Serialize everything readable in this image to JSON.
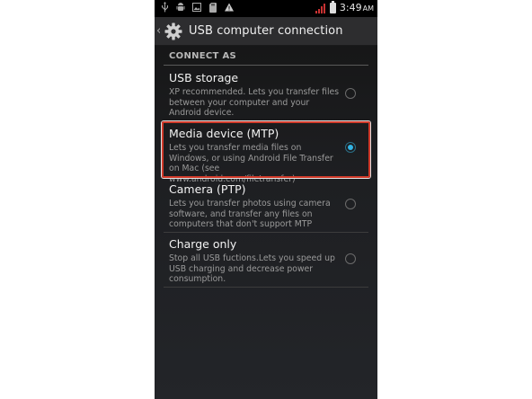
{
  "status_bar": {
    "icons": [
      "usb-icon",
      "android-debug-icon",
      "image-icon",
      "sd-card-icon",
      "warning-icon"
    ],
    "time": "3:49",
    "ampm": "AM"
  },
  "action_bar": {
    "title": "USB computer connection"
  },
  "section": {
    "header": "CONNECT AS"
  },
  "options": [
    {
      "title": "USB storage",
      "summary": "XP recommended. Lets you transfer files between your computer and your Android device.",
      "selected": false
    },
    {
      "title": "Media device (MTP)",
      "summary": "Lets you transfer media files on Windows, or using Android File Transfer on Mac (see www.android.com/filetransfer)",
      "selected": true
    },
    {
      "title": "Camera (PTP)",
      "summary": "Lets you transfer photos using camera software, and transfer any files on computers that don't support MTP",
      "selected": false
    },
    {
      "title": "Charge only",
      "summary": "Stop all USB fuctions.Lets you speed up USB charging and decrease power consumption.",
      "selected": false
    }
  ],
  "colors": {
    "accent": "#33b5e5",
    "highlight": "#d13a2a",
    "background": "#1e1f22"
  }
}
